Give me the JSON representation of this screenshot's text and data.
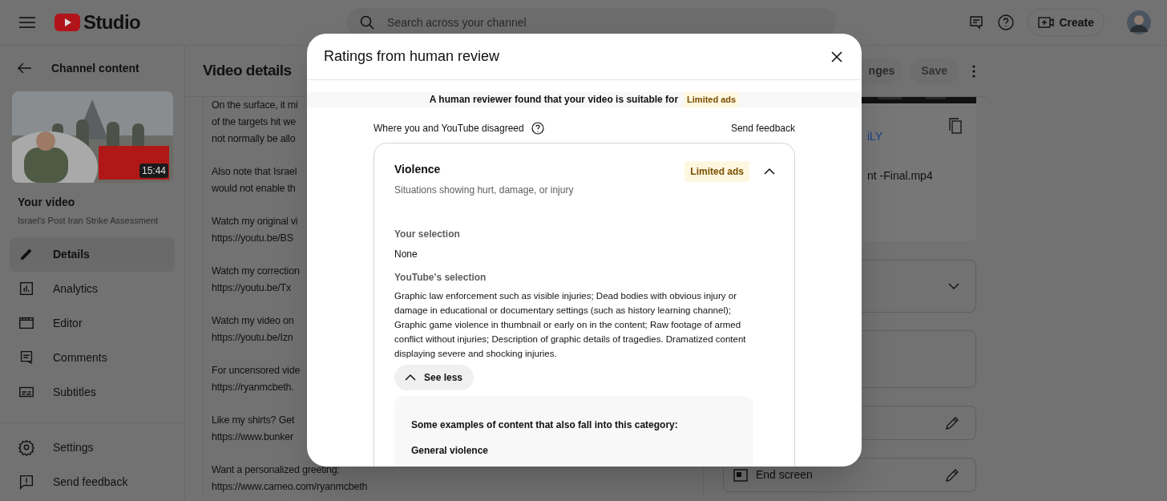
{
  "header": {
    "logo_text": "Studio",
    "search": {
      "placeholder": "Search across your channel"
    },
    "create_button": "Create"
  },
  "sidebar": {
    "back_label": "Channel content",
    "video_duration": "15:44",
    "your_video_label": "Your video",
    "video_title": "Israel's Post Iran Strike Assessment",
    "items": [
      {
        "label": "Details",
        "selected": true
      },
      {
        "label": "Analytics",
        "selected": false
      },
      {
        "label": "Editor",
        "selected": false
      },
      {
        "label": "Comments",
        "selected": false
      },
      {
        "label": "Subtitles",
        "selected": false
      }
    ],
    "footer_items": [
      {
        "label": "Settings"
      },
      {
        "label": "Send feedback"
      }
    ]
  },
  "main": {
    "title": "Video details",
    "undo_button": "nges",
    "save_button": "Save",
    "description": [
      [
        "On the surface, it mi",
        "of the targets hit we",
        "not normally be allo"
      ],
      [
        "Also note that Israel",
        "would not enable th"
      ],
      [
        "Watch my original vi",
        "https://youtu.be/BS"
      ],
      [
        "Watch my correction",
        "https://youtu.be/Tx"
      ],
      [
        "Watch my video on",
        "https://youtu.be/Izn"
      ],
      [
        "For uncensored vide",
        "https://ryanmcbeth."
      ],
      [
        "Like my shirts? Get",
        "https://www.bunker"
      ],
      [
        "Want a personalized greeting:",
        "https://www.cameo.com/ryanmcbeth"
      ]
    ],
    "video_link": "iLY",
    "filename": "nt -Final.mp4",
    "cards": [
      {
        "kind": "dropdown"
      },
      {
        "kind": "empty"
      },
      {
        "kind": "edit"
      },
      {
        "kind": "edit",
        "label": "End screen"
      }
    ]
  },
  "dialog": {
    "title": "Ratings from human review",
    "summary": "A human reviewer found that your video is suitable for",
    "summary_badge": "Limited ads",
    "disagree_label": "Where you and YouTube disagreed",
    "send_feedback": "Send feedback",
    "category": {
      "name": "Violence",
      "description": "Situations showing hurt, damage, or injury",
      "badge": "Limited ads",
      "expanded": true,
      "your_selection_label": "Your selection",
      "your_selection": "None",
      "youtube_selection_label": "YouTube's selection",
      "youtube_selection": "Graphic law enforcement such as visible injuries; Dead bodies with obvious injury or damage in educational or documentary settings (such as history learning channel); Graphic game violence in thumbnail or early on in the content; Raw footage of armed conflict without injuries; Description of graphic details of tragedies. Dramatized content displaying severe and shocking injuries.",
      "see_less": "See less",
      "examples_title": "Some examples of content that also fall into this category:",
      "examples_heading": "General violence"
    }
  }
}
